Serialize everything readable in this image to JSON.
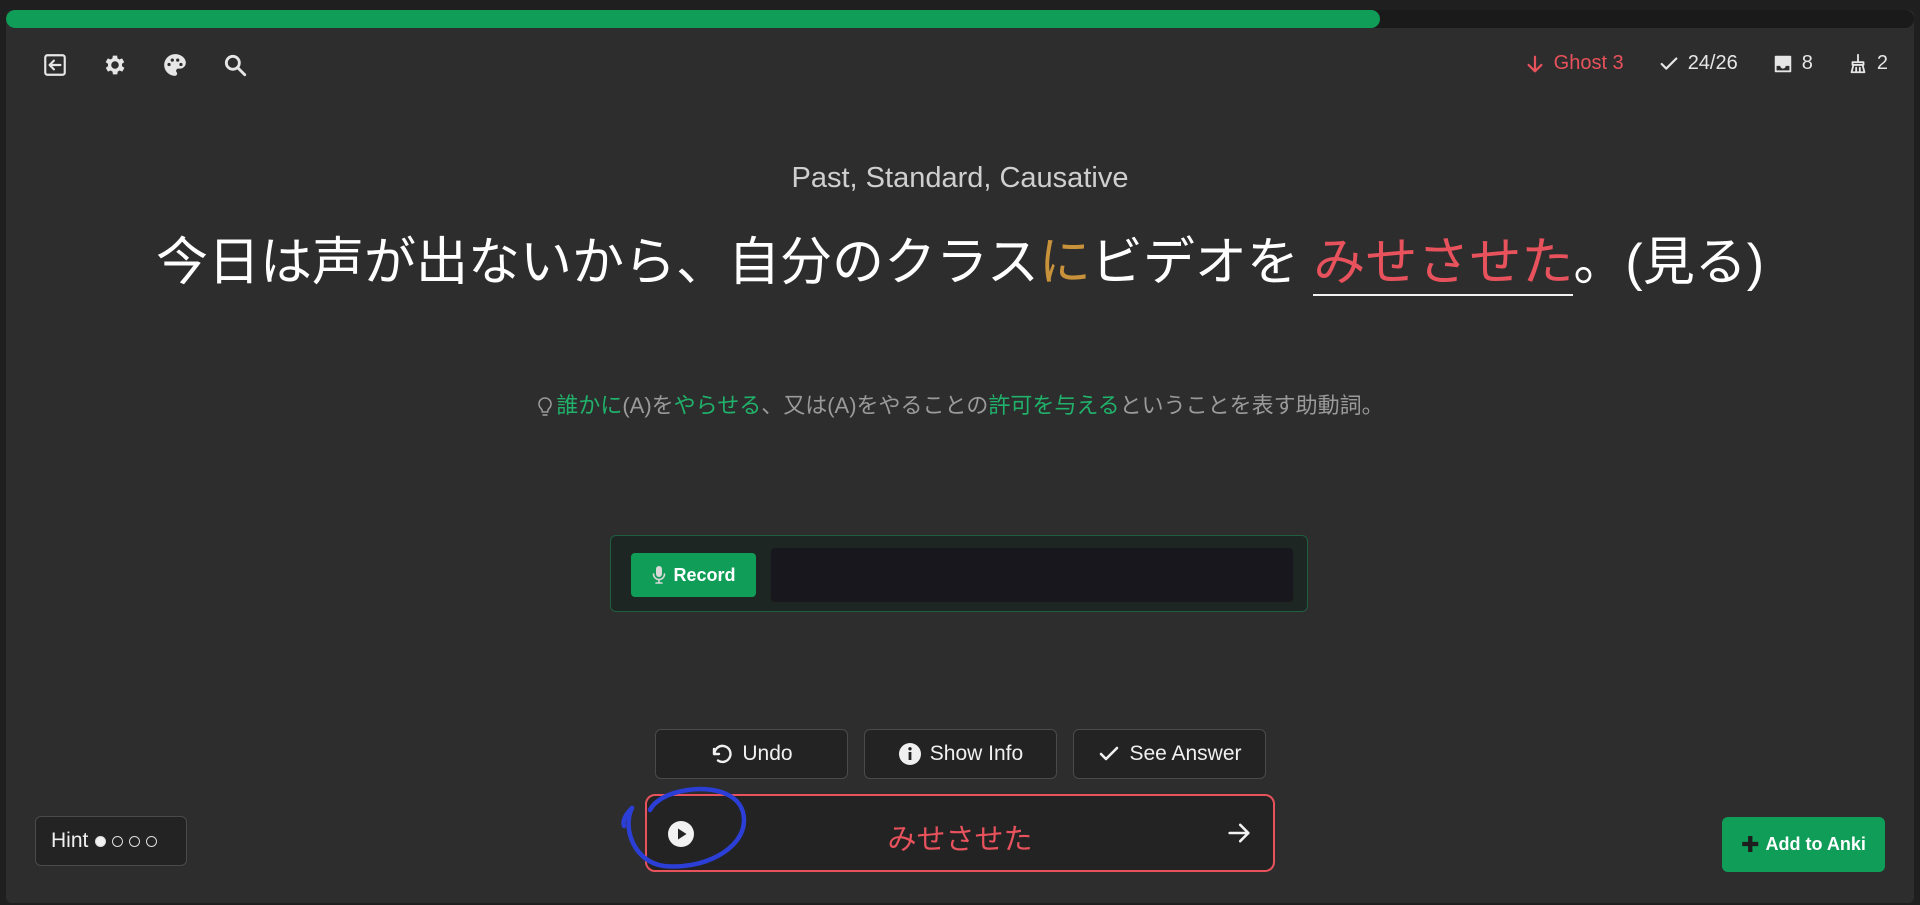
{
  "progress": {
    "fraction": 0.72
  },
  "topbar": {
    "left_icons": [
      "exit-icon",
      "gear-icon",
      "palette-icon",
      "search-icon"
    ],
    "stats": {
      "ghost_label": "Ghost 3",
      "correct_label": "24/26",
      "inbox_label": "8",
      "sweep_label": "2"
    }
  },
  "card": {
    "subtitle": "Past, Standard, Causative",
    "sentence": {
      "before": "今日は声が出ないから、自分のクラス",
      "particle": "に",
      "middle": "ビデオを",
      "answer": "みせさせた",
      "after": "。(見る)"
    },
    "hint": {
      "p1": "誰かに",
      "p2": "(A)を",
      "p3": "やらせる",
      "p4": "、又は(A)をやることの",
      "p5": "許可を与える",
      "p6": "ということを表す助動詞。"
    }
  },
  "record": {
    "button_label": "Record",
    "input_value": ""
  },
  "actions": {
    "undo_label": "Undo",
    "info_label": "Show Info",
    "see_answer_label": "See Answer"
  },
  "answer_box": {
    "text": "みせさせた"
  },
  "hint_control": {
    "label": "Hint",
    "level": 1,
    "max": 4
  },
  "anki": {
    "label": "Add to Anki"
  },
  "colors": {
    "accent_green": "#0f9d58",
    "answer_red": "#e8525c",
    "particle_orange": "#c8923a",
    "annotation_blue": "#2b3fd6"
  }
}
